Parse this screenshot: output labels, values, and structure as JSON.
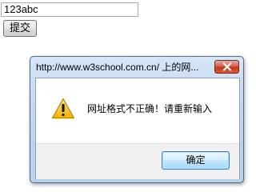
{
  "page": {
    "input_value": "123abc",
    "submit_label": "提交"
  },
  "dialog": {
    "title": "http://www.w3school.com.cn/ 上的网...",
    "message": "网址格式不正确！请重新输入",
    "ok_label": "确定",
    "icons": {
      "close": "close-icon",
      "message": "warning-icon"
    }
  }
}
